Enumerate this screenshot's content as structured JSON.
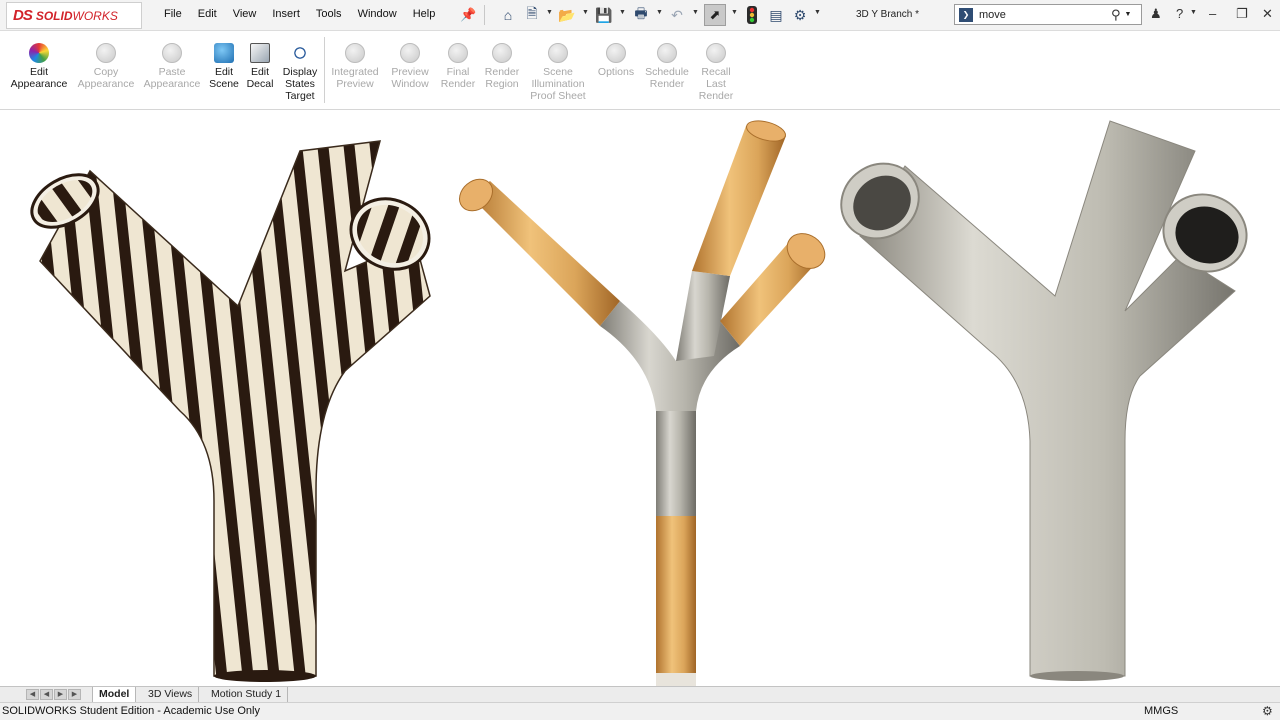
{
  "app": {
    "logo_ds": "DS",
    "logo_solid": "SOLID",
    "logo_works": "WORKS",
    "document_title": "3D Y Branch *"
  },
  "menu": [
    "File",
    "Edit",
    "View",
    "Insert",
    "Tools",
    "Window",
    "Help"
  ],
  "toolbar_icons": [
    "home-icon",
    "new-document-icon",
    "open-icon",
    "save-icon",
    "print-icon",
    "undo-icon",
    "select-icon",
    "traffic-light-icon",
    "file-properties-icon",
    "options-gear-icon"
  ],
  "search": {
    "value": "move",
    "placeholder": ""
  },
  "window_controls": [
    "user-icon",
    "help-icon",
    "minimize-icon",
    "restore-icon",
    "close-icon"
  ],
  "ribbon": {
    "commands": [
      {
        "lines": [
          "Edit",
          "Appearance"
        ],
        "enabled": true,
        "icon": "edit-appearance-icon"
      },
      {
        "lines": [
          "Copy",
          "Appearance"
        ],
        "enabled": false,
        "icon": "copy-appearance-icon"
      },
      {
        "lines": [
          "Paste",
          "Appearance"
        ],
        "enabled": false,
        "icon": "paste-appearance-icon"
      },
      {
        "lines": [
          "Edit",
          "Scene"
        ],
        "enabled": true,
        "icon": "edit-scene-icon"
      },
      {
        "lines": [
          "Edit",
          "Decal"
        ],
        "enabled": true,
        "icon": "edit-decal-icon"
      },
      {
        "lines": [
          "Display",
          "States",
          "Target"
        ],
        "enabled": true,
        "icon": "display-states-target-icon"
      },
      {
        "lines": [
          "Integrated",
          "Preview"
        ],
        "enabled": false,
        "icon": "integrated-preview-icon"
      },
      {
        "lines": [
          "Preview",
          "Window"
        ],
        "enabled": false,
        "icon": "preview-window-icon"
      },
      {
        "lines": [
          "Final",
          "Render"
        ],
        "enabled": false,
        "icon": "final-render-icon"
      },
      {
        "lines": [
          "Render",
          "Region"
        ],
        "enabled": false,
        "icon": "render-region-icon"
      },
      {
        "lines": [
          "Scene",
          "Illumination",
          "Proof Sheet"
        ],
        "enabled": false,
        "icon": "scene-illumination-icon"
      },
      {
        "lines": [
          "Options"
        ],
        "enabled": false,
        "icon": "options-icon"
      },
      {
        "lines": [
          "Schedule",
          "Render"
        ],
        "enabled": false,
        "icon": "schedule-render-icon"
      },
      {
        "lines": [
          "Recall",
          "Last",
          "Render"
        ],
        "enabled": false,
        "icon": "recall-last-render-icon"
      }
    ]
  },
  "viewport": {
    "models": [
      {
        "name": "zebra-stripes",
        "appearance": "zebra stripe"
      },
      {
        "name": "wood-and-metal",
        "appearance": "wood + brushed metal"
      },
      {
        "name": "brushed-metal",
        "appearance": "brushed metal"
      }
    ],
    "colors": {
      "wood": "#d8a25a",
      "metal": "#b9b7ae",
      "zebra_dark": "#2a1a10",
      "zebra_light": "#efe6d2"
    }
  },
  "tabs": {
    "items": [
      "Model",
      "3D Views",
      "Motion Study 1"
    ],
    "active": "Model"
  },
  "status": {
    "edition": "SOLIDWORKS Student Edition - Academic Use Only",
    "units": "MMGS"
  }
}
